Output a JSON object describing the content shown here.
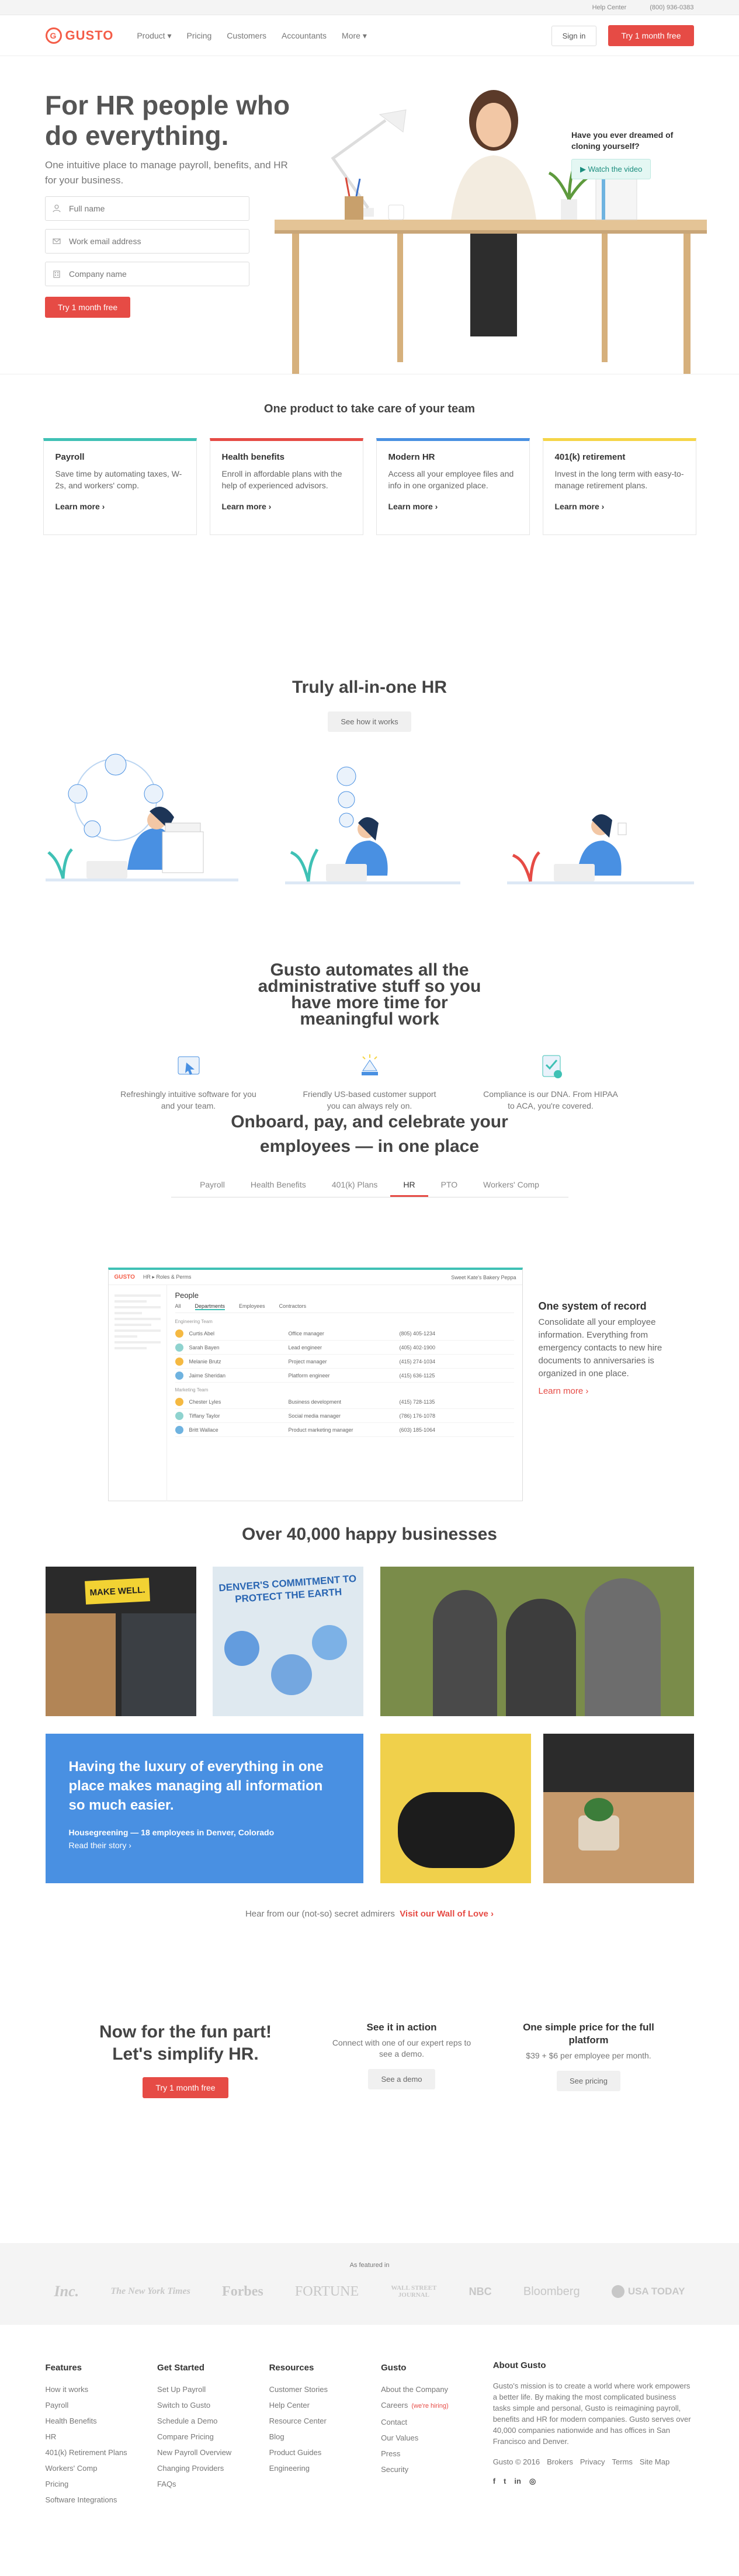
{
  "topbar": {
    "help": "Help Center",
    "phone": "(800) 936-0383"
  },
  "header": {
    "logo_text": "GUSTO",
    "nav": [
      "Product ▾",
      "Pricing",
      "Customers",
      "Accountants",
      "More ▾"
    ],
    "sign_in": "Sign in",
    "cta": "Try 1 month free"
  },
  "hero": {
    "title": "For HR people who do everything.",
    "subtitle": "One intuitive place to manage payroll, benefits, and HR for your business.",
    "fields": [
      {
        "placeholder": "Full name",
        "icon": "person-icon"
      },
      {
        "placeholder": "Work email address",
        "icon": "envelope-icon"
      },
      {
        "placeholder": "Company name",
        "icon": "building-icon"
      }
    ],
    "cta": "Try 1 month free",
    "dream": "Have you ever dreamed of cloning yourself?",
    "watch": "Watch the video"
  },
  "product": {
    "title": "One product to take care of your team",
    "cards": [
      {
        "title": "Payroll",
        "text": "Save time by automating taxes, W-2s, and workers' comp.",
        "more": "Learn more ›",
        "color": "#3fc1b5"
      },
      {
        "title": "Health benefits",
        "text": "Enroll in affordable plans with the help of experienced advisors.",
        "more": "Learn more ›",
        "color": "#e64b45"
      },
      {
        "title": "Modern HR",
        "text": "Access all your employee files and info in one organized place.",
        "more": "Learn more ›",
        "color": "#4990e2"
      },
      {
        "title": "401(k) retirement",
        "text": "Invest in the long term with easy-to-manage retirement plans.",
        "more": "Learn more ›",
        "color": "#f5d547"
      }
    ]
  },
  "aio": {
    "title": "Truly all-in-one HR",
    "button": "See how it works",
    "subtitle": "Gusto automates all the administrative stuff so you have more time for meaningful work",
    "features": [
      {
        "text": "Refreshingly intuitive software for you and your team.",
        "icon": "cursor-icon"
      },
      {
        "text": "Friendly US-based customer support you can always rely on.",
        "icon": "lamp-icon"
      },
      {
        "text": "Compliance is our DNA. From HIPAA to ACA, you're covered.",
        "icon": "checklist-icon"
      }
    ]
  },
  "onboard": {
    "title": "Onboard, pay, and celebrate your employees — in one place",
    "tabs": [
      "Payroll",
      "Health Benefits",
      "401(k) Plans",
      "HR",
      "PTO",
      "Workers' Comp"
    ],
    "active_tab": "HR",
    "mock": {
      "logo": "GUSTO",
      "breadcrumb": "HR ▸ Roles & Perms",
      "company": "Sweet Kate's Bakery Peppa",
      "heading": "People",
      "subtabs": [
        "All",
        "Departments",
        "Employees",
        "Contractors"
      ],
      "groups": [
        {
          "name": "Engineering Team",
          "rows": [
            {
              "name": "Curtis Abel",
              "role": "Office manager",
              "phone": "(805) 405-1234"
            },
            {
              "name": "Sarah Bayen",
              "role": "Lead engineer",
              "phone": "(405) 402-1900"
            },
            {
              "name": "Melanie Brutz",
              "role": "Project manager",
              "phone": "(415) 274-1034"
            },
            {
              "name": "Jaime Sheridan",
              "role": "Platform engineer",
              "phone": "(415) 636-1125"
            }
          ]
        },
        {
          "name": "Marketing Team",
          "rows": [
            {
              "name": "Chester Lyles",
              "role": "Business development",
              "phone": "(415) 728-1135"
            },
            {
              "name": "Tiffany Taylor",
              "role": "Social media manager",
              "phone": "(786) 176-1078"
            },
            {
              "name": "Britt Wallace",
              "role": "Product marketing manager",
              "phone": "(603) 185-1064"
            }
          ]
        }
      ]
    },
    "side_title": "One system of record",
    "side_text": "Consolidate all your employee information. Everything from emergency contacts to new hire documents to anniversaries is organized in one place.",
    "side_link": "Learn more ›"
  },
  "happy": {
    "title": "Over 40,000 happy businesses",
    "sign1": "MAKE WELL.",
    "sign2": "DENVER'S COMMITMENT TO PROTECT THE EARTH",
    "quote": "Having the luxury of everything in one place makes managing all information so much easier.",
    "who": "Housegreening — 18 employees in Denver, Colorado",
    "story": "Read their story ›",
    "wol_text": "Hear from our (not-so) secret admirers",
    "wol_link": "Visit our Wall of Love ›"
  },
  "fun": {
    "title": "Now for the fun part! Let's simplify HR.",
    "cta": "Try 1 month free",
    "demo_title": "See it in action",
    "demo_text": "Connect with one of our expert reps to see a demo.",
    "demo_btn": "See a demo",
    "price_title": "One simple price for the full platform",
    "price_text": "$39 + $6 per employee per month.",
    "price_btn": "See pricing"
  },
  "featured": {
    "label": "As featured in",
    "logos": [
      "Inc.",
      "The New York Times",
      "Forbes",
      "FORTUNE",
      "WALL STREET JOURNAL",
      "NBC",
      "Bloomberg",
      "USA TODAY"
    ]
  },
  "footer": {
    "cols": [
      {
        "title": "Features",
        "links": [
          "How it works",
          "Payroll",
          "Health Benefits",
          "HR",
          "401(k) Retirement Plans",
          "Workers' Comp",
          "Pricing",
          "Software Integrations"
        ]
      },
      {
        "title": "Get Started",
        "links": [
          "Set Up Payroll",
          "Switch to Gusto",
          "Schedule a Demo",
          "Compare Pricing",
          "New Payroll Overview",
          "Changing Providers",
          "FAQs"
        ]
      },
      {
        "title": "Resources",
        "links": [
          "Customer Stories",
          "Help Center",
          "Resource Center",
          "Blog",
          "Product Guides",
          "Engineering"
        ]
      },
      {
        "title": "Gusto",
        "links": [
          "About the Company",
          "Careers",
          "Contact",
          "Our Values",
          "Press",
          "Security"
        ]
      }
    ],
    "hiring": "(we're hiring)",
    "about_title": "About Gusto",
    "about_text": "Gusto's mission is to create a world where work empowers a better life. By making the most complicated business tasks simple and personal, Gusto is reimagining payroll, benefits and HR for modern companies. Gusto serves over 40,000 companies nationwide and has offices in San Francisco and Denver.",
    "legal": [
      "Gusto © 2016",
      "Brokers",
      "Privacy",
      "Terms",
      "Site Map"
    ],
    "social": [
      "facebook-icon",
      "twitter-icon",
      "linkedin-icon",
      "instagram-icon"
    ]
  }
}
